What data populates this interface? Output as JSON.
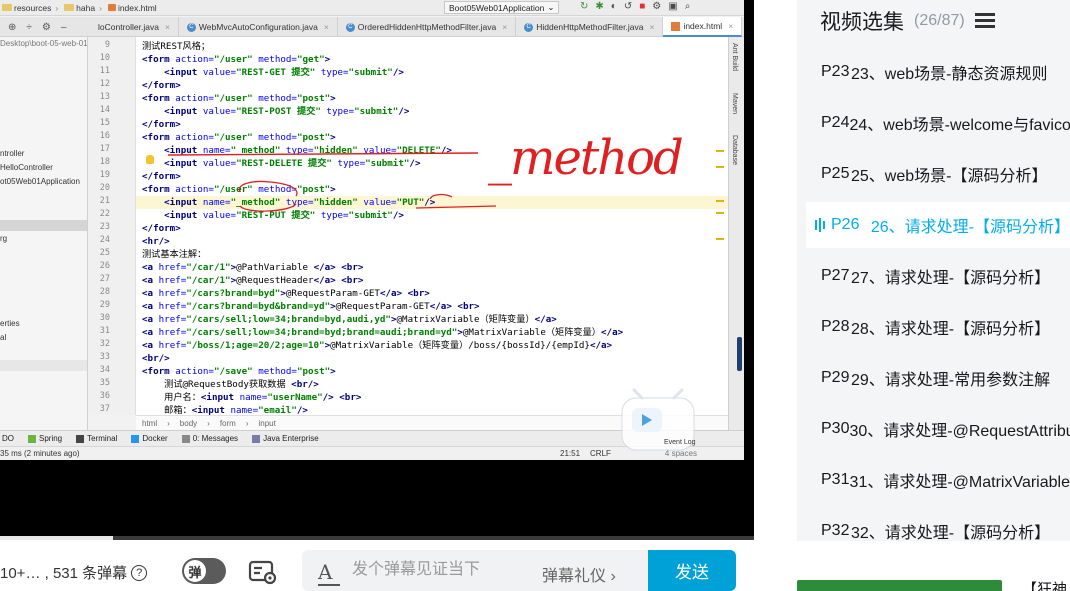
{
  "ide": {
    "breadcrumb": [
      "resources",
      "haha",
      "index.html"
    ],
    "run_config": "Boot05Web01Application",
    "tabs": [
      {
        "label": "loController.java",
        "active": false
      },
      {
        "label": "WebMvcAutoConfiguration.java",
        "active": false
      },
      {
        "label": "OrderedHiddenHttpMethodFilter.java",
        "active": false
      },
      {
        "label": "HiddenHttpMethodFilter.java",
        "active": false
      },
      {
        "label": "index.html",
        "active": true
      }
    ],
    "project_items": [
      "Desktop\\boot-05-web-01",
      "ntroller",
      "HelloController",
      "ot05Web01Application",
      "rg",
      "erties",
      "al"
    ],
    "right_tools": [
      "Ant Build",
      "Maven",
      "Database"
    ],
    "code_lines": [
      {
        "n": "9",
        "html": "测试REST风格；"
      },
      {
        "n": "10",
        "html": "<span class='tg'>&lt;form</span> <span class='at'>action=</span><span class='st'>\"/user\"</span> <span class='at'>method=</span><span class='st'>\"get\"</span><span class='tg'>&gt;</span>"
      },
      {
        "n": "11",
        "html": "    <span class='tg'>&lt;input</span> <span class='at'>value=</span><span class='st'>\"REST-GET 提交\"</span> <span class='at'>type=</span><span class='st'>\"submit\"</span><span class='tg'>/&gt;</span>"
      },
      {
        "n": "12",
        "html": "<span class='tg'>&lt;/form&gt;</span>"
      },
      {
        "n": "13",
        "html": "<span class='tg'>&lt;form</span> <span class='at'>action=</span><span class='st'>\"/user\"</span> <span class='at'>method=</span><span class='st'>\"post\"</span><span class='tg'>&gt;</span>"
      },
      {
        "n": "14",
        "html": "    <span class='tg'>&lt;input</span> <span class='at'>value=</span><span class='st'>\"REST-POST 提交\"</span> <span class='at'>type=</span><span class='st'>\"submit\"</span><span class='tg'>/&gt;</span>"
      },
      {
        "n": "15",
        "html": "<span class='tg'>&lt;/form&gt;</span>"
      },
      {
        "n": "16",
        "html": "<span class='tg'>&lt;form</span> <span class='at'>action=</span><span class='st'>\"/user\"</span> <span class='at'>method=</span><span class='st'>\"post\"</span><span class='tg'>&gt;</span>"
      },
      {
        "n": "17",
        "html": "    <span class='tg'>&lt;input</span> <span class='at'>name=</span><span class='st'>\"_method\"</span> <span class='at'>type=</span><span class='st'>\"hidden\"</span> <span class='at'>value=</span><span class='st'>\"DELETE\"</span><span class='tg'>/&gt;</span>"
      },
      {
        "n": "18",
        "html": "    <span class='tg'>&lt;input</span> <span class='at'>value=</span><span class='st'>\"REST-DELETE 提交\"</span> <span class='at'>type=</span><span class='st'>\"submit\"</span><span class='tg'>/&gt;</span>"
      },
      {
        "n": "19",
        "html": "<span class='tg'>&lt;/form&gt;</span>"
      },
      {
        "n": "20",
        "html": "<span class='tg'>&lt;form</span> <span class='at'>action=</span><span class='st'>\"/user\"</span> <span class='at'>method=</span><span class='st'>\"post\"</span><span class='tg'>&gt;</span>"
      },
      {
        "n": "21",
        "html": "    <span class='tg'>&lt;input</span> <span class='at'>name=</span><span class='st'>\"_method\"</span> <span class='at'>type=</span><span class='st'>\"hidden\"</span> <span class='at'>value=</span><span class='st'>\"PUT\"</span><span class='tg'>/&gt;</span>",
        "highlight": true
      },
      {
        "n": "22",
        "html": "    <span class='tg'>&lt;input</span> <span class='at'>value=</span><span class='st'>\"REST-PUT 提交\"</span> <span class='at'>type=</span><span class='st'>\"submit\"</span><span class='tg'>/&gt;</span>"
      },
      {
        "n": "23",
        "html": "<span class='tg'>&lt;/form&gt;</span>"
      },
      {
        "n": "24",
        "html": "<span class='tg'>&lt;hr/&gt;</span>"
      },
      {
        "n": "25",
        "html": "测试基本注解："
      },
      {
        "n": "26",
        "html": "<span class='tg'>&lt;a</span> <span class='at'>href=</span><span class='st'>\"/car/1\"</span><span class='tg'>&gt;</span>@PathVariable <span class='tg'>&lt;/a&gt;</span> <span class='tg'>&lt;br&gt;</span>"
      },
      {
        "n": "27",
        "html": "<span class='tg'>&lt;a</span> <span class='at'>href=</span><span class='st'>\"/car/1\"</span><span class='tg'>&gt;</span>@RequestHeader<span class='tg'>&lt;/a&gt;</span> <span class='tg'>&lt;br&gt;</span>"
      },
      {
        "n": "28",
        "html": "<span class='tg'>&lt;a</span> <span class='at'>href=</span><span class='st'>\"/cars?brand=byd\"</span><span class='tg'>&gt;</span>@RequestParam-GET<span class='tg'>&lt;/a&gt;</span> <span class='tg'>&lt;br&gt;</span>"
      },
      {
        "n": "29",
        "html": "<span class='tg'>&lt;a</span> <span class='at'>href=</span><span class='st'>\"/cars?brand=byd&amp;brand=yd\"</span><span class='tg'>&gt;</span>@RequestParam-GET<span class='tg'>&lt;/a&gt;</span> <span class='tg'>&lt;br&gt;</span>"
      },
      {
        "n": "30",
        "html": "<span class='tg'>&lt;a</span> <span class='at'>href=</span><span class='st'>\"/cars/sell;low=34;brand=byd,audi,yd\"</span><span class='tg'>&gt;</span>@MatrixVariable（矩阵变量）<span class='tg'>&lt;/a&gt;</span>"
      },
      {
        "n": "31",
        "html": "<span class='tg'>&lt;a</span> <span class='at'>href=</span><span class='st'>\"/cars/sell;low=34;brand=byd;brand=audi;brand=yd\"</span><span class='tg'>&gt;</span>@MatrixVariable（矩阵变量）<span class='tg'>&lt;/a&gt;</span>"
      },
      {
        "n": "32",
        "html": "<span class='tg'>&lt;a</span> <span class='at'>href=</span><span class='st'>\"/boss/1;age=20/2;age=10\"</span><span class='tg'>&gt;</span>@MatrixVariable（矩阵变量）/boss/{bossId}/{empId}<span class='tg'>&lt;/a&gt;</span>"
      },
      {
        "n": "33",
        "html": "<span class='tg'>&lt;br/&gt;</span>"
      },
      {
        "n": "34",
        "html": "<span class='tg'>&lt;form</span> <span class='at'>action=</span><span class='st'>\"/save\"</span> <span class='at'>method=</span><span class='st'>\"post\"</span><span class='tg'>&gt;</span>"
      },
      {
        "n": "35",
        "html": "    测试@RequestBody获取数据 <span class='tg'>&lt;br/&gt;</span>"
      },
      {
        "n": "36",
        "html": "    用户名：<span class='tg'>&lt;input</span> <span class='at'>name=</span><span class='st'>\"userName\"</span><span class='tg'>/&gt;</span> <span class='tg'>&lt;br&gt;</span>"
      },
      {
        "n": "37",
        "html": "    邮箱：<span class='tg'>&lt;input</span> <span class='at'>name=</span><span class='st'>\"email\"</span><span class='tg'>/&gt;</span>"
      }
    ],
    "html_crumb": [
      "html",
      "body",
      "form",
      "input"
    ],
    "tool_tabs": [
      "DO",
      "Spring",
      "Terminal",
      "Docker",
      "0: Messages",
      "Java Enterprise"
    ],
    "status_left": "35 ms (2 minutes ago)",
    "status_cursor": "21:51",
    "status_crlf": "CRLF",
    "status_right_extra": "4 spaces",
    "event_log": "Event Log",
    "annotation_text": "_method"
  },
  "player": {
    "progress": 0.15
  },
  "danmaku": {
    "viewer_info": "10+… , 531 条弹幕",
    "help_icon": "?",
    "toggle_label": "弹",
    "placeholder": "发个弹幕见证当下",
    "gift_label": "弹幕礼仪",
    "send_label": "发送",
    "font_icon": "A"
  },
  "playlist": {
    "title": "视频选集",
    "count": "(26/87)",
    "items": [
      {
        "p": "P23",
        "title": "23、web场景-静态资源规则"
      },
      {
        "p": "P24",
        "title": "24、web场景-welcome与favicon"
      },
      {
        "p": "P25",
        "title": "25、web场景-【源码分析】"
      },
      {
        "p": "P26",
        "title": "26、请求处理-【源码分析】",
        "active": true
      },
      {
        "p": "P27",
        "title": "27、请求处理-【源码分析】"
      },
      {
        "p": "P28",
        "title": "28、请求处理-【源码分析】"
      },
      {
        "p": "P29",
        "title": "29、请求处理-常用参数注解"
      },
      {
        "p": "P30",
        "title": "30、请求处理-@RequestAttribute"
      },
      {
        "p": "P31",
        "title": "31、请求处理-@MatrixVariable"
      },
      {
        "p": "P32",
        "title": "32、请求处理-【源码分析】"
      }
    ],
    "ad_text": "【狂神"
  }
}
